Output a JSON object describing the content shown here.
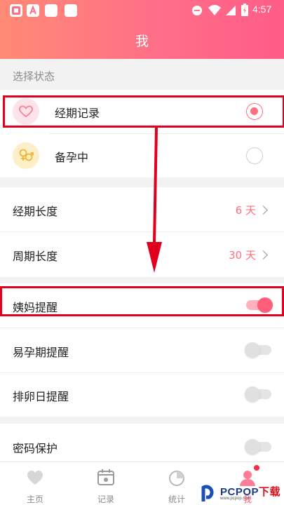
{
  "statusbar": {
    "time": "4:57",
    "left_icons": [
      "notification-icon",
      "app-a-icon",
      "app-icon",
      "app-icon"
    ],
    "right_icons": [
      "do-not-disturb-icon",
      "wifi-icon",
      "signal-icon",
      "battery-icon"
    ]
  },
  "header": {
    "title": "我",
    "gradient_start": "#ff8a75",
    "gradient_end": "#ff5c88"
  },
  "status_section": {
    "label": "选择状态",
    "options": [
      {
        "label": "经期记录",
        "icon": "heart-icon",
        "selected": true
      },
      {
        "label": "备孕中",
        "icon": "gender-icon",
        "selected": false
      }
    ]
  },
  "settings": [
    {
      "label": "经期长度",
      "value": "6 天"
    },
    {
      "label": "周期长度",
      "value": "30 天"
    }
  ],
  "reminders": [
    {
      "label": "姨妈提醒",
      "on": true
    },
    {
      "label": "易孕期提醒",
      "on": false
    },
    {
      "label": "排卵日提醒",
      "on": false
    }
  ],
  "privacy": {
    "label": "密码保护",
    "on": false
  },
  "tabbar": {
    "tabs": [
      {
        "label": "主页",
        "icon": "heart-tab-icon",
        "active": false
      },
      {
        "label": "记录",
        "icon": "calendar-tab-icon",
        "active": false
      },
      {
        "label": "统计",
        "icon": "chart-tab-icon",
        "active": false
      },
      {
        "label": "我",
        "icon": "profile-tab-icon",
        "active": true
      }
    ]
  },
  "watermark": {
    "brand_main": "PCPOP",
    "brand_suffix": "下载",
    "sub": "www.pcpop.com"
  },
  "colors": {
    "accent": "#ff6f7f",
    "highlight_box": "#e0001e",
    "arrow": "#e0001e"
  }
}
